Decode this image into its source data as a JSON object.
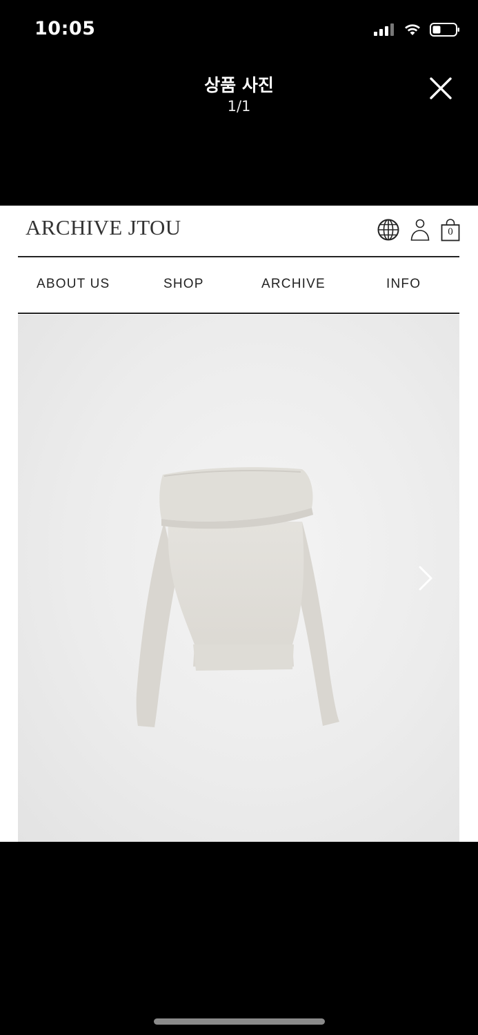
{
  "status_bar": {
    "time": "10:05"
  },
  "viewer": {
    "title": "상품 사진",
    "counter": "1/1"
  },
  "site": {
    "logo": "ARCHIVE JTOU",
    "cart_count": "0",
    "nav": [
      {
        "label": "ABOUT US"
      },
      {
        "label": "SHOP"
      },
      {
        "label": "ARCHIVE"
      },
      {
        "label": "INFO"
      }
    ]
  },
  "icons": {
    "globe": "globe-icon",
    "account": "user-icon",
    "cart": "shopping-bag-icon",
    "next": "chevron-right-icon",
    "close": "close-icon"
  }
}
